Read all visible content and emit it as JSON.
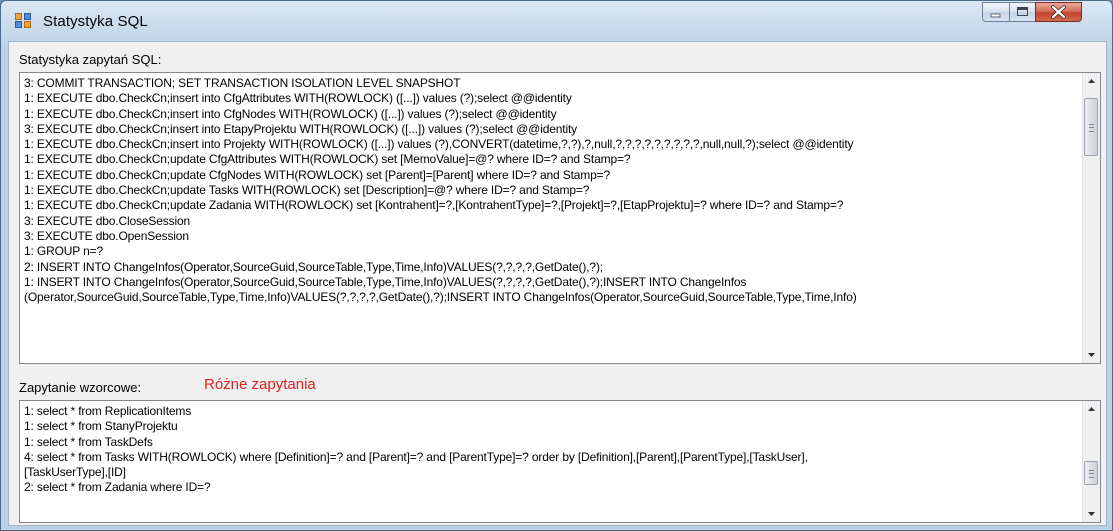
{
  "window": {
    "title": "Statystyka SQL"
  },
  "stats": {
    "label": "Statystyka zapytań SQL:",
    "lines": [
      "3: COMMIT TRANSACTION; SET TRANSACTION ISOLATION LEVEL SNAPSHOT",
      "1: EXECUTE dbo.CheckCn;insert into CfgAttributes WITH(ROWLOCK) ([...]) values (?);select @@identity",
      "1: EXECUTE dbo.CheckCn;insert into CfgNodes WITH(ROWLOCK) ([...]) values (?);select @@identity",
      "3: EXECUTE dbo.CheckCn;insert into EtapyProjektu WITH(ROWLOCK) ([...]) values (?);select @@identity",
      "1: EXECUTE dbo.CheckCn;insert into Projekty WITH(ROWLOCK) ([...]) values (?),CONVERT(datetime,?,?),?,null,?,?,?,?,?,?,?,?,?,null,null,?);select @@identity",
      "1: EXECUTE dbo.CheckCn;update CfgAttributes WITH(ROWLOCK) set [MemoValue]=@? where ID=? and Stamp=?",
      "1: EXECUTE dbo.CheckCn;update CfgNodes WITH(ROWLOCK) set [Parent]=[Parent] where ID=? and Stamp=?",
      "1: EXECUTE dbo.CheckCn;update Tasks WITH(ROWLOCK) set [Description]=@? where ID=? and Stamp=?",
      "1: EXECUTE dbo.CheckCn;update Zadania WITH(ROWLOCK) set [Kontrahent]=?,[KontrahentType]=?,[Projekt]=?,[EtapProjektu]=? where ID=? and Stamp=?",
      "3: EXECUTE dbo.CloseSession",
      "3: EXECUTE dbo.OpenSession",
      "1: GROUP n=?",
      "2: INSERT INTO ChangeInfos(Operator,SourceGuid,SourceTable,Type,Time,Info)VALUES(?,?,?,?,GetDate(),?);",
      "1: INSERT INTO ChangeInfos(Operator,SourceGuid,SourceTable,Type,Time,Info)VALUES(?,?,?,?,GetDate(),?);INSERT INTO ChangeInfos",
      "(Operator,SourceGuid,SourceTable,Type,Time,Info)VALUES(?,?,?,?,GetDate(),?);INSERT INTO ChangeInfos(Operator,SourceGuid,SourceTable,Type,Time,Info)"
    ]
  },
  "pattern": {
    "label": "Zapytanie wzorcowe:",
    "annotation": "Różne zapytania",
    "lines": [
      "1: select * from ReplicationItems",
      "1: select * from StanyProjektu",
      "1: select * from TaskDefs",
      "4: select * from Tasks WITH(ROWLOCK) where [Definition]=? and [Parent]=? and [ParentType]=? order by [Definition],[Parent],[ParentType],[TaskUser],",
      "[TaskUserType],[ID]",
      "2: select * from Zadania where ID=?"
    ]
  },
  "icons": {
    "app": "app-window-icon",
    "minimize": "minimize-icon",
    "maximize": "maximize-icon",
    "close": "close-icon",
    "up": "scroll-up-arrow-icon",
    "down": "scroll-down-arrow-icon"
  },
  "colors": {
    "annotation": "#e02020",
    "close_button": "#c2432f"
  }
}
